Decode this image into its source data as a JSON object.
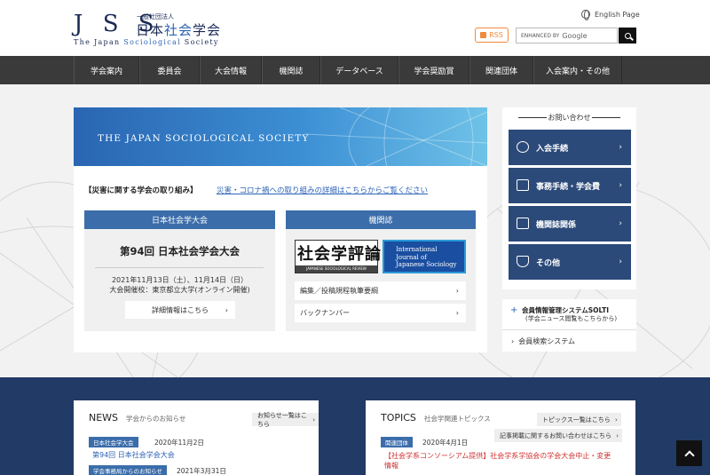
{
  "logo": {
    "letters": "J S S",
    "corp": "一般社団法人",
    "ja_a": "日本",
    "ja_b": "社会",
    "ja_c": "学会",
    "en_a": "The Japan ",
    "en_b": "Sociological",
    "en_c": " Society"
  },
  "header": {
    "english_link": "English Page",
    "rss": "RSS",
    "search_enhanced": "ENHANCED BY",
    "search_brand": "Google"
  },
  "nav": [
    "学会案内",
    "委員会",
    "大会情報",
    "機関誌",
    "データベース",
    "学会奨励賞",
    "関連団体",
    "入会案内・その他"
  ],
  "banner": {
    "text": "THE JAPAN SOCIOLOGICAL SOCIETY"
  },
  "disaster": {
    "label": "【災害に関する学会の取り組み】",
    "link": "災害・コロナ禍への取り組みの詳細はこちらからご覧ください"
  },
  "conference": {
    "header": "日本社会学大会",
    "title": "第94回 日本社会学会大会",
    "date": "2021年11月13日（土）、11月14日（日）",
    "venue": "大会開催校：東京都立大学(オンライン開催)",
    "button": "詳細情報はこちら"
  },
  "journal": {
    "header": "機関誌",
    "logo1_big": "社会学評論",
    "logo1_small": "JAPANESE SOCIOLOGICAL REVIEW",
    "logo2_l1": "International",
    "logo2_l2": "Journal of",
    "logo2_l3": "Japanese Sociology",
    "rows": [
      "編集／投稿規程執筆要綱",
      "バックナンバー"
    ]
  },
  "side": {
    "title": "お問い合わせ",
    "buttons": [
      "入会手続",
      "事務手続・学会費",
      "機関誌関係",
      "その他"
    ]
  },
  "solti": {
    "title": "会員情報管理システムSOLTI",
    "sub": "(学会ニュース閲覧もこちらから)",
    "link": "会員検索システム"
  },
  "news": {
    "title": "NEWS",
    "sub": "学会からのお知らせ",
    "more": "お知らせ一覧はこちら",
    "items": [
      {
        "tag": "日本社会学大会",
        "date": "2020年11月2日",
        "text": "第94回 日本社会学会大会"
      },
      {
        "tag": "学会事務局からのお知らせ",
        "date": "2021年3月31日"
      }
    ]
  },
  "topics": {
    "title": "TOPICS",
    "sub": "社会学関連トピックス",
    "more": "トピックス一覧はこちら",
    "more2": "記事掲載に関するお問い合わせはこちら",
    "items": [
      {
        "tag": "関連団体",
        "date": "2020年4月1日",
        "text1": "【社会学系コンソーシアム提供】社会学系学協会の学会大会中止・変更",
        "text2": "情報"
      }
    ]
  },
  "colors": {
    "nav": "#3a3a3a",
    "accent": "#3b6daa",
    "side_button": "#2b4a79",
    "footer": "#213b66"
  }
}
